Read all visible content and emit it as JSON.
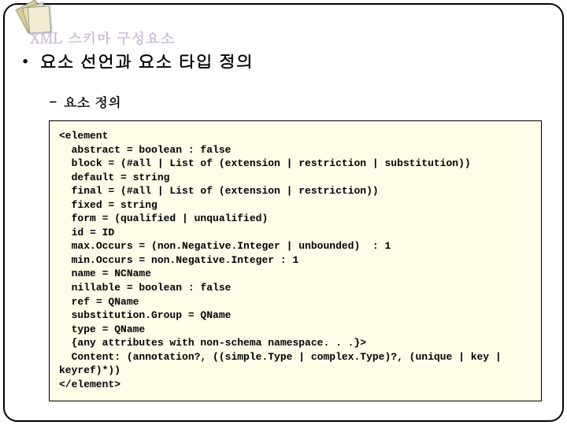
{
  "decor": {
    "faded_title": "XML 스키마 구성요소"
  },
  "bullet": {
    "marker": "•",
    "text": "요소 선언과 요소 타입 정의"
  },
  "sub": {
    "marker": "-",
    "text": "요소 정의"
  },
  "code": {
    "lines": [
      "<element",
      "  abstract = boolean : false",
      "  block = (#all | List of (extension | restriction | substitution))",
      "  default = string",
      "  final = (#all | List of (extension | restriction))",
      "  fixed = string",
      "  form = (qualified | unqualified)",
      "  id = ID",
      "  max.Occurs = (non.Negative.Integer | unbounded)  : 1",
      "  min.Occurs = non.Negative.Integer : 1",
      "  name = NCName",
      "  nillable = boolean : false",
      "  ref = QName",
      "  substitution.Group = QName",
      "  type = QName",
      "  {any attributes with non-schema namespace. . .}>",
      "  Content: (annotation?, ((simple.Type | complex.Type)?, (unique | key | keyref)*))",
      "</element>"
    ]
  }
}
